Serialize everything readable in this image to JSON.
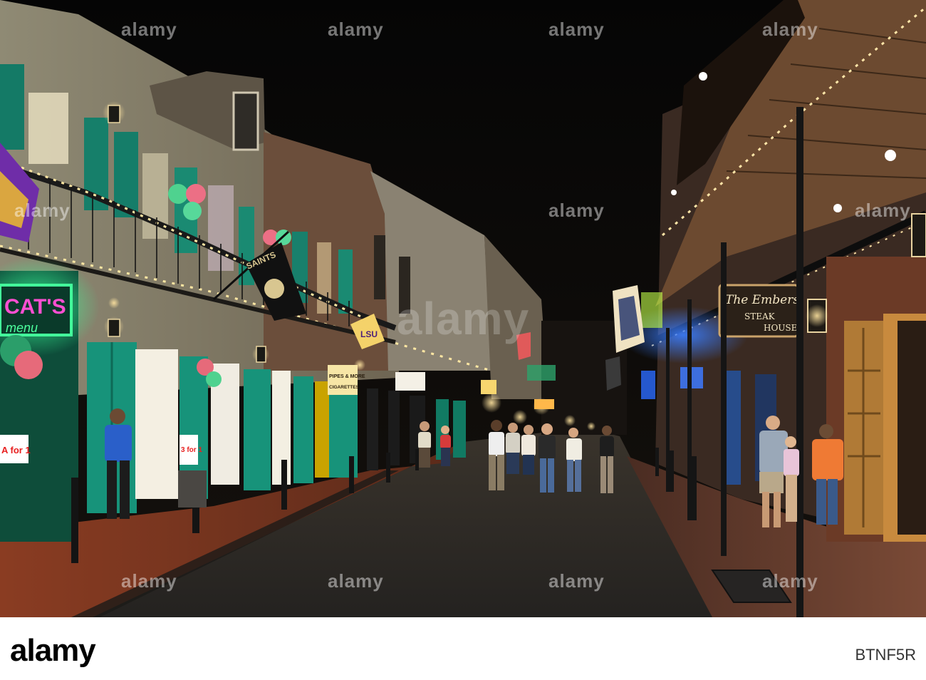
{
  "photo": {
    "signs": {
      "the_embers": "The Embers",
      "steak": "STEAK",
      "house": "HOUSE",
      "neon_cats": "CAT'S",
      "saints_flag": "SAINTS",
      "lsu_flag": "LSU",
      "pipes_cigarettes": "PIPES & MORE",
      "cigarettes": "CIGARETTES",
      "for_one": "3 for 1",
      "for_one_left": "A for 1"
    },
    "colors": {
      "sky": "#0a0908",
      "street": "#2e2b29",
      "neon_green": "#29ff8c",
      "shutter_teal": "#128b72",
      "warm_light": "#ffd98a",
      "neon_pink": "#ff3ec8"
    }
  },
  "watermark": {
    "brand": "alamy",
    "image_id": "BTNF5R"
  }
}
